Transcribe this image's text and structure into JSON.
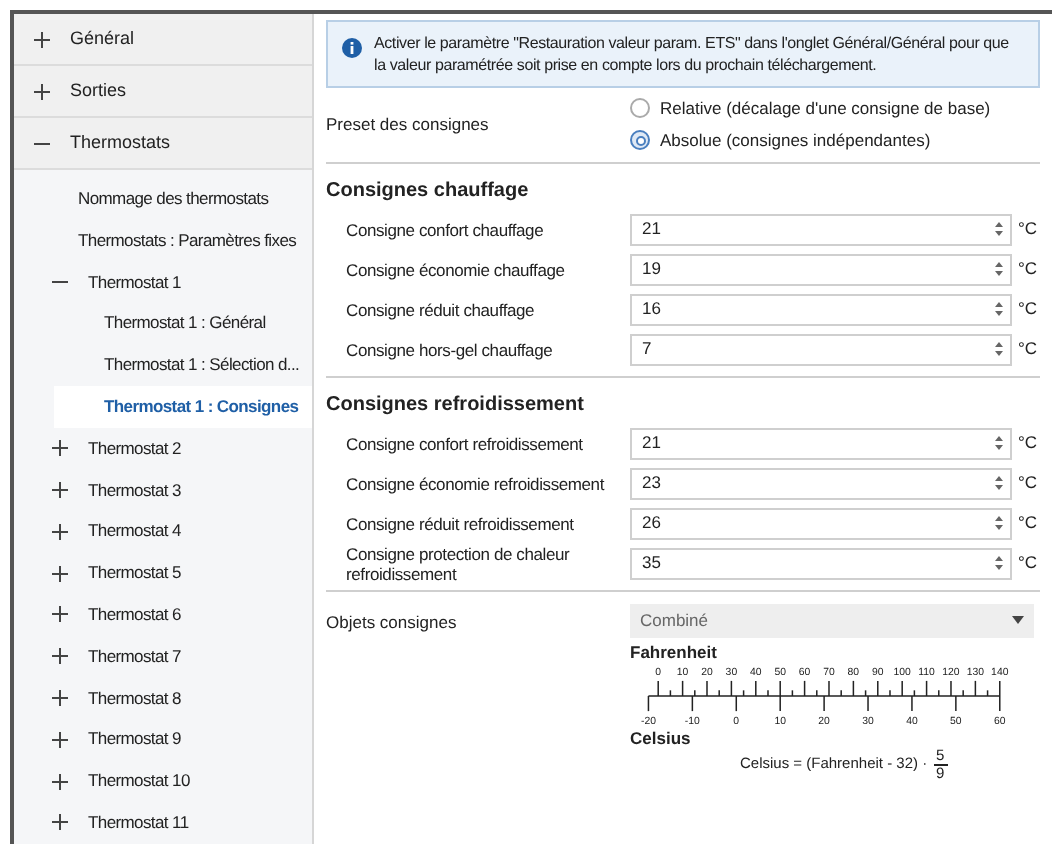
{
  "sidebar": {
    "items": [
      {
        "label": "Général",
        "expanded": false,
        "selected": false
      },
      {
        "label": "Sorties",
        "expanded": false,
        "selected": false
      },
      {
        "label": "Thermostats",
        "expanded": true,
        "selected": false,
        "children": [
          {
            "label": "Nommage des thermostats",
            "selected": false
          },
          {
            "label": "Thermostats : Paramètres fixes",
            "selected": false
          },
          {
            "label": "Thermostat 1",
            "expanded": true,
            "selected": false,
            "children": [
              {
                "label": "Thermostat 1 : Général",
                "selected": false
              },
              {
                "label": "Thermostat 1 : Sélection d...",
                "selected": false
              },
              {
                "label": "Thermostat 1 : Consignes",
                "selected": true
              }
            ]
          },
          {
            "label": "Thermostat 2",
            "expanded": false,
            "selected": false
          },
          {
            "label": "Thermostat 3",
            "expanded": false,
            "selected": false
          },
          {
            "label": "Thermostat 4",
            "expanded": false,
            "selected": false
          },
          {
            "label": "Thermostat 5",
            "expanded": false,
            "selected": false
          },
          {
            "label": "Thermostat 6",
            "expanded": false,
            "selected": false
          },
          {
            "label": "Thermostat 7",
            "expanded": false,
            "selected": false
          },
          {
            "label": "Thermostat 8",
            "expanded": false,
            "selected": false
          },
          {
            "label": "Thermostat 9",
            "expanded": false,
            "selected": false
          },
          {
            "label": "Thermostat 10",
            "expanded": false,
            "selected": false
          },
          {
            "label": "Thermostat 11",
            "expanded": false,
            "selected": false
          }
        ]
      }
    ]
  },
  "notice": "Activer le paramètre \"Restauration valeur param. ETS\" dans l'onglet Général/Général pour que la valeur paramétrée soit prise en compte lors du prochain téléchargement.",
  "preset": {
    "label": "Preset des consignes",
    "options": [
      {
        "label": "Relative (décalage d'une consigne de base)",
        "selected": false
      },
      {
        "label": "Absolue (consignes indépendantes)",
        "selected": true
      }
    ]
  },
  "sections": [
    {
      "title": "Consignes chauffage",
      "rows": [
        {
          "label": "Consigne confort chauffage",
          "value": "21",
          "unit": "°C"
        },
        {
          "label": "Consigne économie chauffage",
          "value": "19",
          "unit": "°C"
        },
        {
          "label": "Consigne réduit chauffage",
          "value": "16",
          "unit": "°C"
        },
        {
          "label": "Consigne hors-gel chauffage",
          "value": "7",
          "unit": "°C"
        }
      ]
    },
    {
      "title": "Consignes refroidissement",
      "rows": [
        {
          "label": "Consigne confort refroidissement",
          "value": "21",
          "unit": "°C"
        },
        {
          "label": "Consigne économie refroidissement",
          "value": "23",
          "unit": "°C"
        },
        {
          "label": "Consigne réduit refroidissement",
          "value": "26",
          "unit": "°C"
        },
        {
          "label": "Consigne protection de chaleur refroidissement",
          "value": "35",
          "unit": "°C"
        }
      ]
    }
  ],
  "objects": {
    "label": "Objets consignes",
    "value": "Combiné"
  },
  "scale": {
    "top_title": "Fahrenheit",
    "fahrenheit_ticks": [
      "0",
      "10",
      "20",
      "30",
      "40",
      "50",
      "60",
      "70",
      "80",
      "90",
      "100",
      "110",
      "120",
      "130",
      "140"
    ],
    "celsius_ticks": [
      "-20",
      "-10",
      "0",
      "10",
      "20",
      "30",
      "40",
      "50",
      "60"
    ],
    "bottom_title": "Celsius",
    "formula": "Celsius = (Fahrenheit - 32) ·",
    "numerator": "5",
    "denominator": "9"
  }
}
